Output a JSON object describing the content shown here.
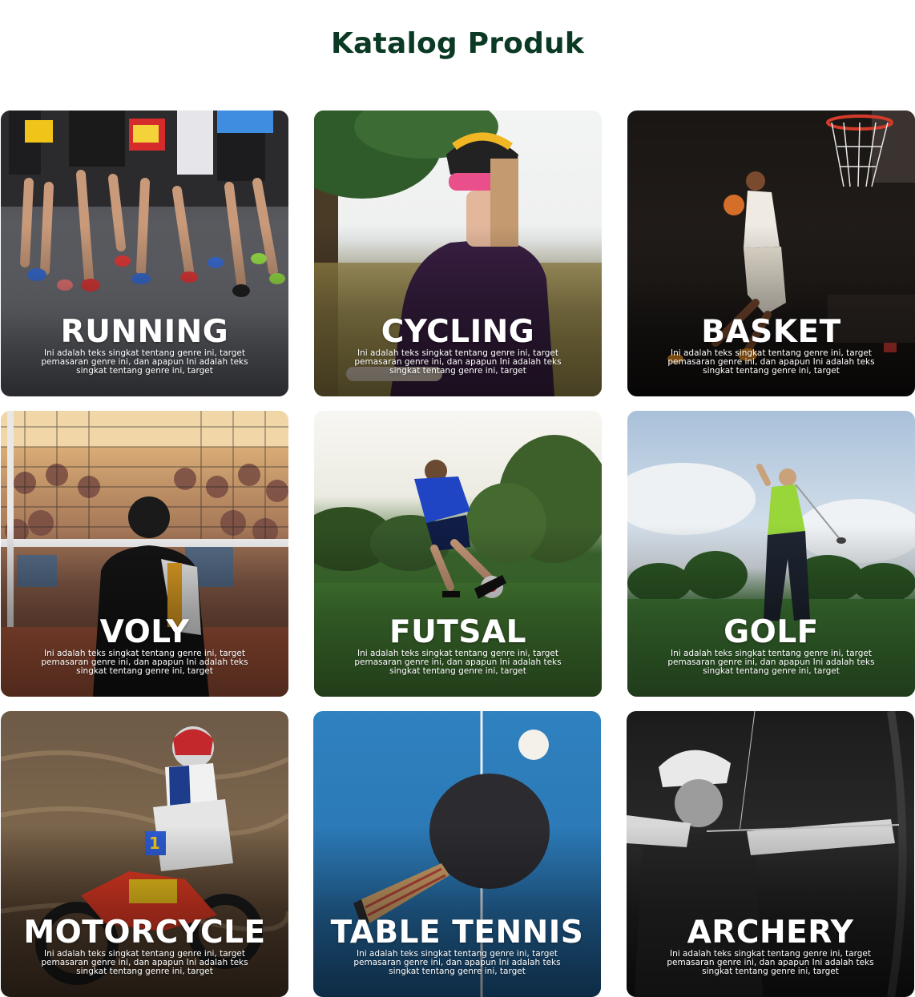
{
  "page": {
    "title": "Katalog Produk"
  },
  "cards": [
    {
      "name": "RUNNING",
      "description": "Ini adalah teks singkat tentang genre ini, target pemasaran genre ini, dan apapun Ini adalah teks singkat tentang genre ini, target"
    },
    {
      "name": "CYCLING",
      "description": "Ini adalah teks singkat tentang genre ini, target pemasaran genre ini, dan apapun Ini adalah teks singkat tentang genre ini, target"
    },
    {
      "name": "BASKET",
      "description": "Ini adalah teks singkat tentang genre ini, target pemasaran genre ini, dan apapun Ini adalah teks singkat tentang genre ini, target"
    },
    {
      "name": "VOLY",
      "description": "Ini adalah teks singkat tentang genre ini, target pemasaran genre ini, dan apapun Ini adalah teks singkat tentang genre ini, target"
    },
    {
      "name": "FUTSAL",
      "description": "Ini adalah teks singkat tentang genre ini, target pemasaran genre ini, dan apapun Ini adalah teks singkat tentang genre ini, target"
    },
    {
      "name": "GOLF",
      "description": "Ini adalah teks singkat tentang genre ini, target pemasaran genre ini, dan apapun Ini adalah teks singkat tentang genre ini, target"
    },
    {
      "name": "MOTORCYCLE",
      "description": "Ini adalah teks singkat tentang genre ini, target pemasaran genre ini, dan apapun Ini adalah teks singkat tentang genre ini, target"
    },
    {
      "name": "TABLE TENNIS",
      "description": "Ini adalah teks singkat tentang genre ini, target pemasaran genre ini, dan apapun Ini adalah teks singkat tentang genre ini, target"
    },
    {
      "name": "ARCHERY",
      "description": "Ini adalah teks singkat tentang genre ini, target pemasaran genre ini, dan apapun Ini adalah teks singkat tentang genre ini, target"
    }
  ],
  "colors": {
    "title": "#0b3a24",
    "card_text": "#ffffff"
  }
}
